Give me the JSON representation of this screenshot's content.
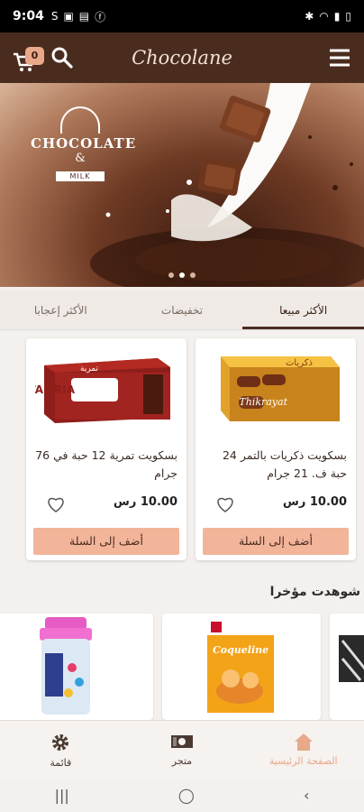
{
  "status_bar": {
    "time": "9:04",
    "left_icons": [
      "s-icon",
      "photo-icon",
      "image-icon",
      "facebook-icon"
    ],
    "right_icons": [
      "bluetooth-icon",
      "wifi-icon",
      "signal-icon",
      "battery-icon"
    ]
  },
  "app_bar": {
    "cart_count": "0",
    "logo": "Chocolane"
  },
  "banner": {
    "brand_top": "CHOCOLATE",
    "brand_amp": "&",
    "brand_bottom": "MILK"
  },
  "tabs": [
    {
      "label": "الأكثر مبيعا",
      "active": true
    },
    {
      "label": "تخفيضات",
      "active": false
    },
    {
      "label": "الأكثر إعجابا",
      "active": false
    }
  ],
  "products": [
    {
      "title": "بسكويت ذكريات بالتمر 24 حبة ف. 21 جرام",
      "price": "10.00 رس",
      "add_label": "أضف إلى السلة",
      "image_text": "Thikrayat",
      "image_text_ar": "ذكريات"
    },
    {
      "title": "بسكويت تمرية 12 حبة في 76 جرام",
      "price": "10.00 رس",
      "add_label": "أضف إلى السلة",
      "image_text": "TAMRIA",
      "image_text_ar": "تمرية"
    }
  ],
  "recent": {
    "title": "شوهدت مؤخرا",
    "items": [
      {
        "image_text": "Coqueline"
      },
      {
        "image_text": ""
      },
      {
        "image_text": ""
      }
    ]
  },
  "bottom_nav": [
    {
      "label": "الصفحة الرئيسية",
      "icon": "home-icon",
      "active": true
    },
    {
      "label": "متجر",
      "icon": "store-icon",
      "active": false
    },
    {
      "label": "قائمة",
      "icon": "gear-icon",
      "active": false
    }
  ],
  "colors": {
    "brand": "#4a2c1e",
    "accent": "#f2b59a",
    "badge": "#e8a98a"
  }
}
